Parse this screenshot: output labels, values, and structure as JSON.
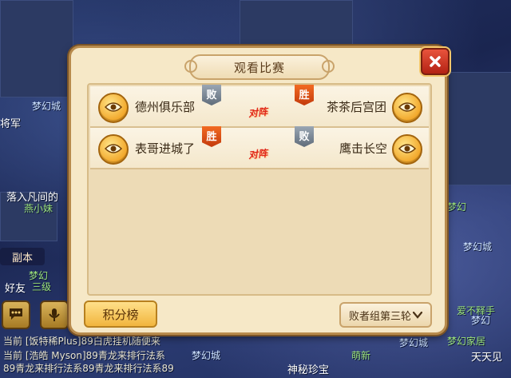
{
  "dialog": {
    "title": "观看比赛",
    "vs_label": "对阵",
    "matches": [
      {
        "left_team": "德州俱乐部",
        "left_result": "败",
        "right_team": "茶茶后宫团",
        "right_result": "胜"
      },
      {
        "left_team": "表哥进城了",
        "left_result": "胜",
        "right_team": "鹰击长空",
        "right_result": "败"
      }
    ],
    "rank_button": "积分榜",
    "round_select": "败者组第三轮"
  },
  "world": {
    "labels": {
      "a": "梦幻城",
      "b": "将军",
      "c": "落入凡间的",
      "d": "燕小妹",
      "e": "好友",
      "f": "梦幻",
      "g": "三级",
      "h": "梦幻城",
      "i": "萌新",
      "j": "神秘珍宝",
      "k": "梦幻",
      "l": "梦幻城",
      "m": "爱不释手",
      "n": "梦幻城",
      "o": "梦幻家居",
      "p": "梦幻",
      "q": "天天见"
    },
    "dungeon_button": "副本",
    "chat": [
      "当前 [饭特稀Plus]89白虎挂机随便来",
      "当前 [浩皓 Myson]89青龙来排行法系",
      "89青龙来排行法系89青龙来排行法系89"
    ]
  },
  "colors": {
    "win": "#e0561a",
    "lose": "#7a8795",
    "panel": "#f6e8c7",
    "frame": "#b88b4d"
  }
}
